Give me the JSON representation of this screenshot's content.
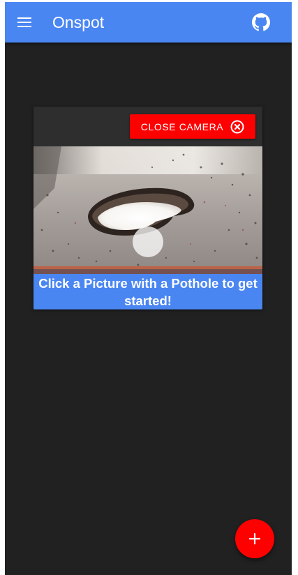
{
  "app_bar": {
    "title": "Onspot",
    "menu_icon": "menu-icon",
    "github_icon": "github-icon",
    "color": "#4a86f2"
  },
  "camera_card": {
    "close_button_label": "CLOSE CAMERA",
    "close_icon": "close-circle-icon",
    "close_button_color": "#ff0000",
    "feed_subject": "pothole-camera-feed",
    "prompt_text": "Click a Picture with a Pothole to get started!"
  },
  "fab": {
    "icon": "plus-icon",
    "color": "#ff0000"
  },
  "theme": {
    "background": "#212121"
  }
}
